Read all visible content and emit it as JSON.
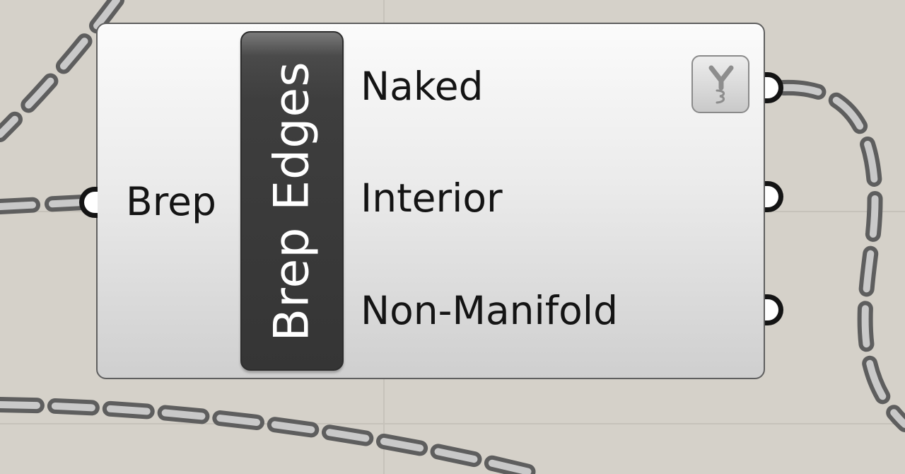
{
  "canvas": {
    "background_color": "#d5d1c9",
    "wire_color": "#6d6d6d"
  },
  "component": {
    "nickname": "Brep Edges",
    "inputs": [
      {
        "label": "Brep"
      }
    ],
    "outputs": [
      {
        "label": "Naked",
        "flag_icon": "graft-icon"
      },
      {
        "label": "Interior"
      },
      {
        "label": "Non-Manifold"
      }
    ]
  }
}
